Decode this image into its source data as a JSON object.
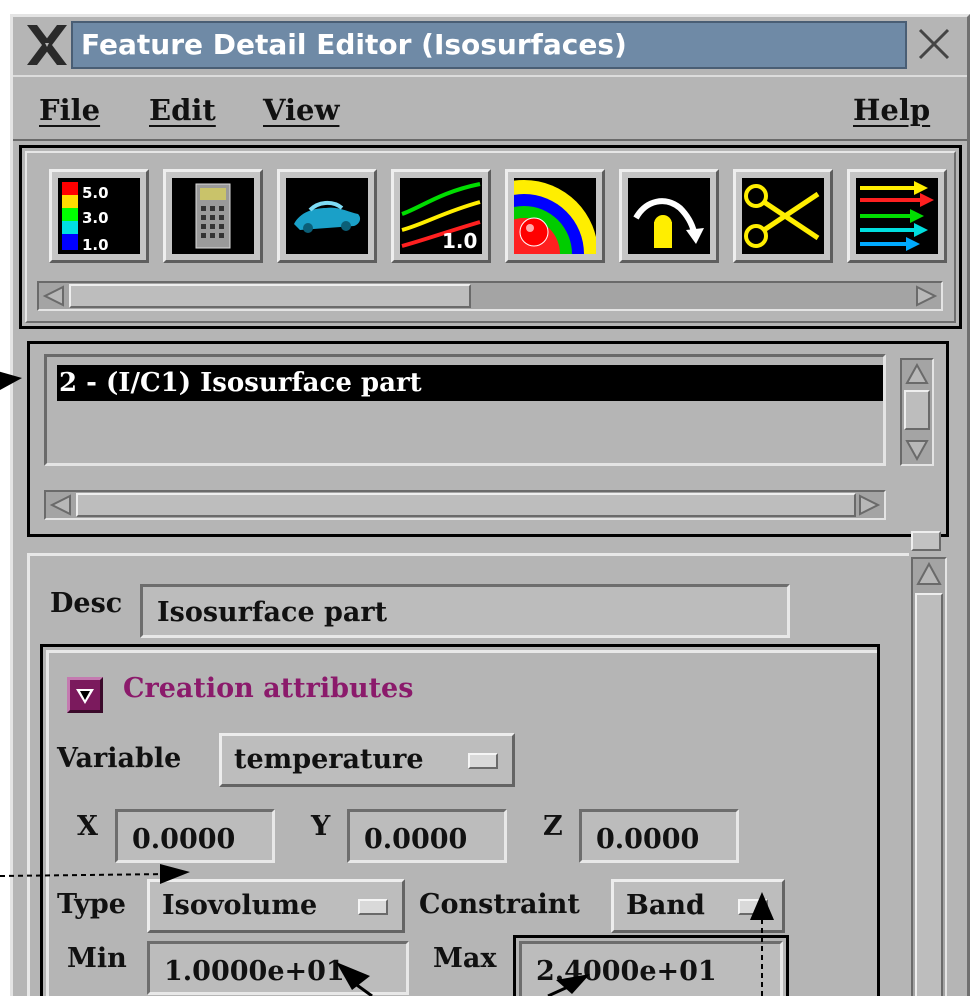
{
  "window": {
    "title": "Feature Detail Editor (Isosurfaces)"
  },
  "menu": {
    "file": "File",
    "edit": "Edit",
    "view": "View",
    "help": "Help"
  },
  "toolbar": {
    "tools": [
      {
        "name": "color-palette-tool",
        "icon": "palette-legend-icon",
        "labels": [
          "5.0",
          "3.0",
          "1.0"
        ]
      },
      {
        "name": "calculator-tool",
        "icon": "calculator-icon"
      },
      {
        "name": "model-part-tool",
        "icon": "car-model-icon"
      },
      {
        "name": "contour-tool",
        "icon": "contour-lines-icon",
        "label": "1.0"
      },
      {
        "name": "isosurface-tool",
        "icon": "isosurface-icon"
      },
      {
        "name": "particle-trace-tool",
        "icon": "particle-trace-icon"
      },
      {
        "name": "clip-tool",
        "icon": "scissors-icon"
      },
      {
        "name": "vector-arrows-tool",
        "icon": "vector-arrows-icon"
      }
    ]
  },
  "parts_list": {
    "items": [
      "2 - (I/C1) Isosurface part"
    ],
    "selected_index": 0
  },
  "desc": {
    "label": "Desc",
    "value": "Isosurface part"
  },
  "creation": {
    "header": "Creation attributes",
    "header_color": "#8b1a6b",
    "variable": {
      "label": "Variable",
      "value": "temperature"
    },
    "x": {
      "label": "X",
      "value": "0.0000"
    },
    "y": {
      "label": "Y",
      "value": "0.0000"
    },
    "z": {
      "label": "Z",
      "value": "0.0000"
    },
    "type": {
      "label": "Type",
      "value": "Isovolume"
    },
    "constraint": {
      "label": "Constraint",
      "value": "Band"
    },
    "min": {
      "label": "Min",
      "value": "1.0000e+01"
    },
    "max": {
      "label": "Max",
      "value": "2.4000e+01"
    }
  }
}
